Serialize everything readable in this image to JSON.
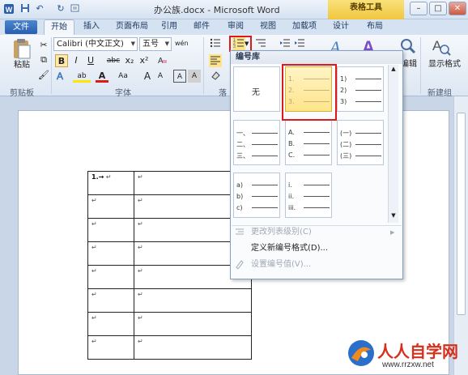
{
  "window": {
    "title": "办公族.docx - Microsoft Word",
    "contextual_tab_group": "表格工具",
    "controls": {
      "minimize": "–",
      "maximize": "□",
      "close": "✕"
    }
  },
  "quick_access": {
    "save_icon": "💾",
    "undo_icon": "↶",
    "redo_icon": "↻"
  },
  "tabs": {
    "file": "文件",
    "home": "开始",
    "insert": "插入",
    "page_layout": "页面布局",
    "references": "引用",
    "mailings": "邮件",
    "review": "审阅",
    "view": "视图",
    "addins": "加载项",
    "design": "设计",
    "layout": "布局"
  },
  "ribbon": {
    "clipboard": {
      "label": "剪贴板",
      "paste": "粘贴"
    },
    "font": {
      "label": "字体",
      "name": "Calibri (中文正文)",
      "size": "五号",
      "bold": "B",
      "italic": "I",
      "underline": "U",
      "strike": "abc",
      "subscript": "x₂",
      "superscript": "x²",
      "grow": "A",
      "shrink": "A",
      "change_case": "Aa",
      "highlight": "ab",
      "font_color": "A",
      "clear": "A",
      "char_border": "A",
      "phonetic": "wén"
    },
    "paragraph": {
      "partial_label": "落"
    },
    "styles": {
      "partial_label": "编辑"
    },
    "new_group": {
      "label": "新建组",
      "show_format": "显示格式"
    }
  },
  "numbering_library": {
    "title": "编号库",
    "items": [
      {
        "kind": "none",
        "text": "无"
      },
      {
        "kind": "decimal-dot",
        "lines": [
          "1.",
          "2.",
          "3."
        ]
      },
      {
        "kind": "decimal-paren",
        "lines": [
          "1)",
          "2)",
          "3)"
        ]
      },
      {
        "kind": "cjk-comma",
        "lines": [
          "一、",
          "二、",
          "三、"
        ]
      },
      {
        "kind": "upper-alpha",
        "lines": [
          "A.",
          "B.",
          "C."
        ]
      },
      {
        "kind": "cjk-paren",
        "lines": [
          "(一)",
          "(二)",
          "(三)"
        ]
      },
      {
        "kind": "lower-alpha",
        "lines": [
          "a)",
          "b)",
          "c)"
        ]
      },
      {
        "kind": "lower-roman",
        "lines": [
          "i.",
          "ii.",
          "iii."
        ]
      }
    ],
    "menu": {
      "change_level": "更改列表级别(C)",
      "define_new": "定义新编号格式(D)...",
      "set_value": "设置编号值(V)..."
    }
  },
  "document": {
    "first_cell": "1.→",
    "cell_mark": "↵",
    "rows": 8
  },
  "watermark": {
    "brand": "人人自学网",
    "url": "www.rrzxw.net"
  },
  "colors": {
    "accent": "#2a5fae",
    "highlight_border": "#e01818",
    "selected_fill": "#ffe48a"
  }
}
